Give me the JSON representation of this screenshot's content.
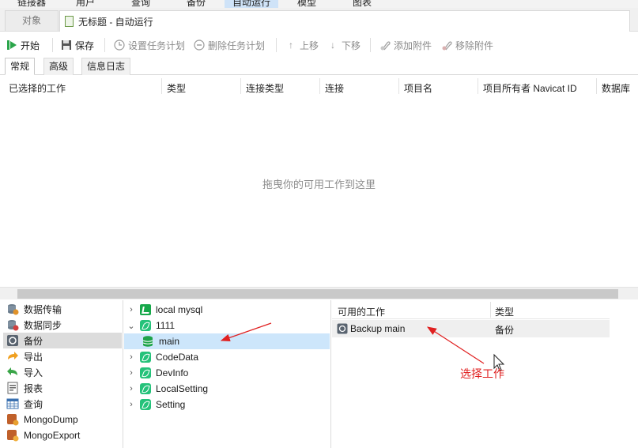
{
  "menubar": {
    "items": [
      {
        "label": "链接器"
      },
      {
        "label": "用户"
      },
      {
        "label": "查询"
      },
      {
        "label": "备份"
      },
      {
        "label": "自动运行"
      },
      {
        "label": "模型"
      },
      {
        "label": "图表"
      }
    ],
    "active_index": 4
  },
  "tabs": {
    "objects_label": "对象",
    "document_title": "无标题 - 自动运行"
  },
  "toolbar": {
    "start": "开始",
    "save": "保存",
    "set_schedule": "设置任务计划",
    "delete_schedule": "删除任务计划",
    "move_up": "上移",
    "move_down": "下移",
    "add_attachment": "添加附件",
    "remove_attachment": "移除附件"
  },
  "subtabs": [
    "常规",
    "高级",
    "信息日志"
  ],
  "grid": {
    "columns": [
      "已选择的工作",
      "类型",
      "连接类型",
      "连接",
      "项目名",
      "项目所有者 Navicat ID",
      "数据库"
    ],
    "empty_text": "拖曳你的可用工作到这里"
  },
  "categories": [
    {
      "label": "数据传输",
      "icon": "data-transfer-icon"
    },
    {
      "label": "数据同步",
      "icon": "data-sync-icon"
    },
    {
      "label": "备份",
      "icon": "backup-icon"
    },
    {
      "label": "导出",
      "icon": "export-icon"
    },
    {
      "label": "导入",
      "icon": "import-icon"
    },
    {
      "label": "报表",
      "icon": "report-icon"
    },
    {
      "label": "查询",
      "icon": "query-icon"
    },
    {
      "label": "MongoDump",
      "icon": "mongodump-icon"
    },
    {
      "label": "MongoExport",
      "icon": "mongoexport-icon"
    }
  ],
  "tree": {
    "connections": [
      {
        "label": "local mysql"
      },
      {
        "label": "1111",
        "children": [
          {
            "label": "main"
          }
        ]
      },
      {
        "label": "CodeData"
      },
      {
        "label": "DevInfo"
      },
      {
        "label": "LocalSetting"
      },
      {
        "label": "Setting"
      }
    ]
  },
  "available": {
    "columns": [
      "可用的工作",
      "类型"
    ],
    "rows": [
      {
        "name": "Backup main",
        "type": "备份"
      }
    ]
  },
  "annotation": {
    "text": "选择工作",
    "color": "#e02020"
  },
  "colors": {
    "accent_selection": "#cde6fb",
    "active_menu": "#cfe3f8",
    "start_green": "#2aa54a"
  }
}
